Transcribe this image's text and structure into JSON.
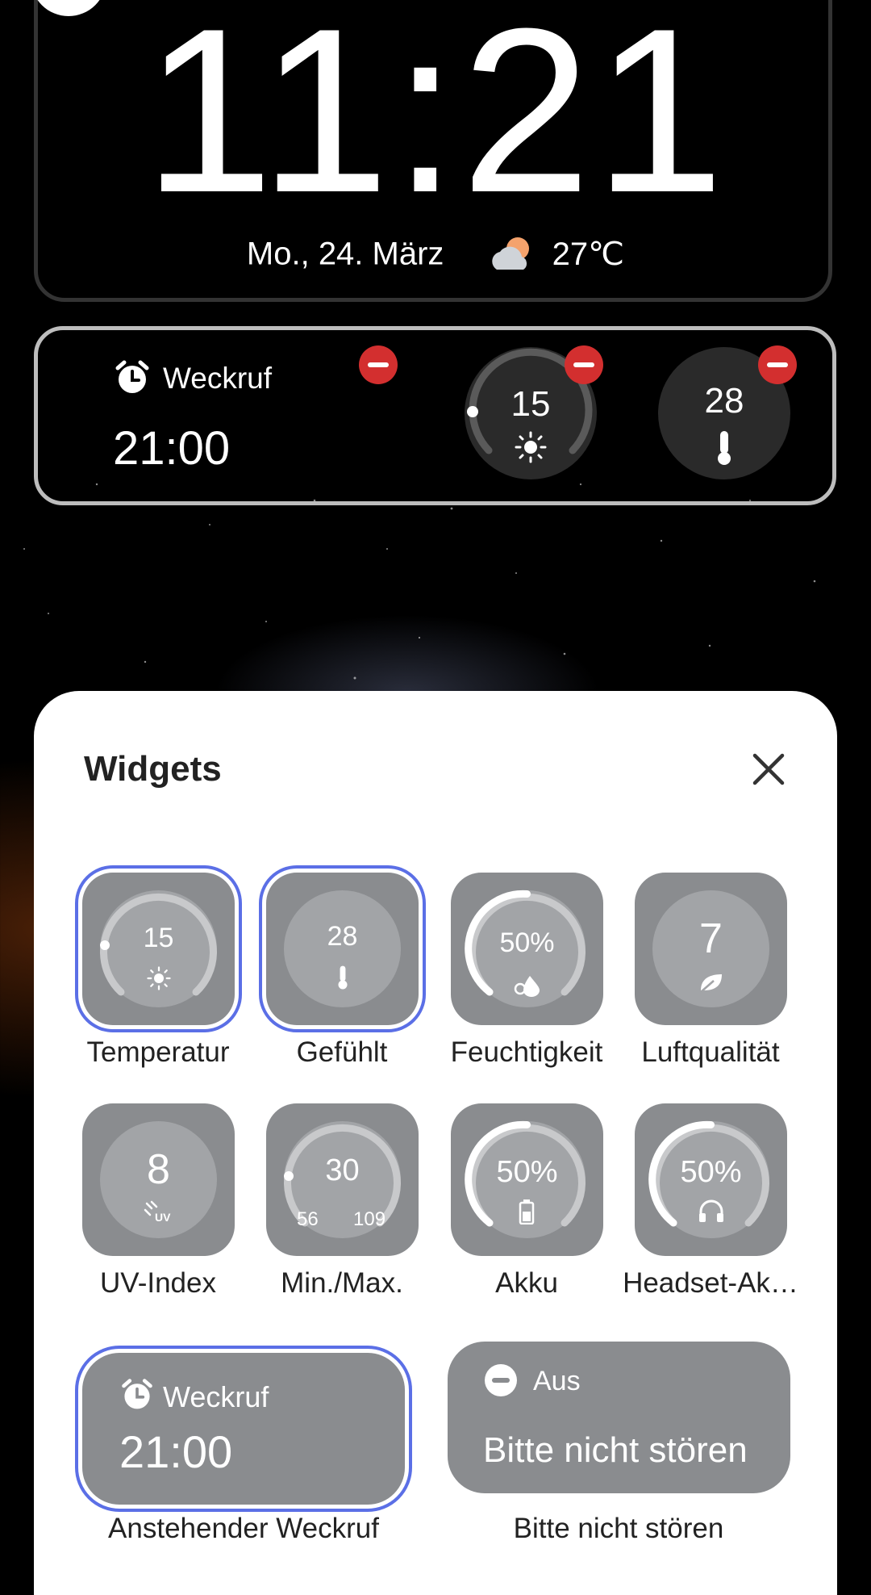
{
  "lock_screen": {
    "clock": "11:21",
    "date": "Mo., 24. März",
    "temperature": "27℃",
    "weather_icon": "partly-cloudy-icon"
  },
  "active_widgets": {
    "alarm_label": "Weckruf",
    "alarm_time": "21:00",
    "temperature_value": "15",
    "feels_like_value": "28"
  },
  "sheet": {
    "title": "Widgets",
    "tiles": [
      {
        "label": "Temperatur",
        "value": "15",
        "selected": true
      },
      {
        "label": "Gefühlt",
        "value": "28",
        "selected": true
      },
      {
        "label": "Feuchtigkeit",
        "value": "50%",
        "selected": false
      },
      {
        "label": "Luftqualität",
        "value": "7",
        "selected": false
      },
      {
        "label": "UV-Index",
        "value": "8",
        "selected": false
      },
      {
        "label": "Min./Max.",
        "value": "30",
        "min": "56",
        "max": "109",
        "selected": false
      },
      {
        "label": "Akku",
        "value": "50%",
        "selected": false
      },
      {
        "label": "Headset-Ak…",
        "value": "50%",
        "selected": false
      }
    ],
    "alarm_tile": {
      "title": "Weckruf",
      "time": "21:00",
      "label": "Anstehender Weckruf",
      "selected": true
    },
    "dnd_tile": {
      "status": "Aus",
      "title": "Bitte nicht stören",
      "label": "Bitte nicht stören",
      "selected": false
    }
  },
  "colors": {
    "selection": "#5b6fe6",
    "remove": "#d32f2f",
    "tile": "#8a8c8f"
  }
}
